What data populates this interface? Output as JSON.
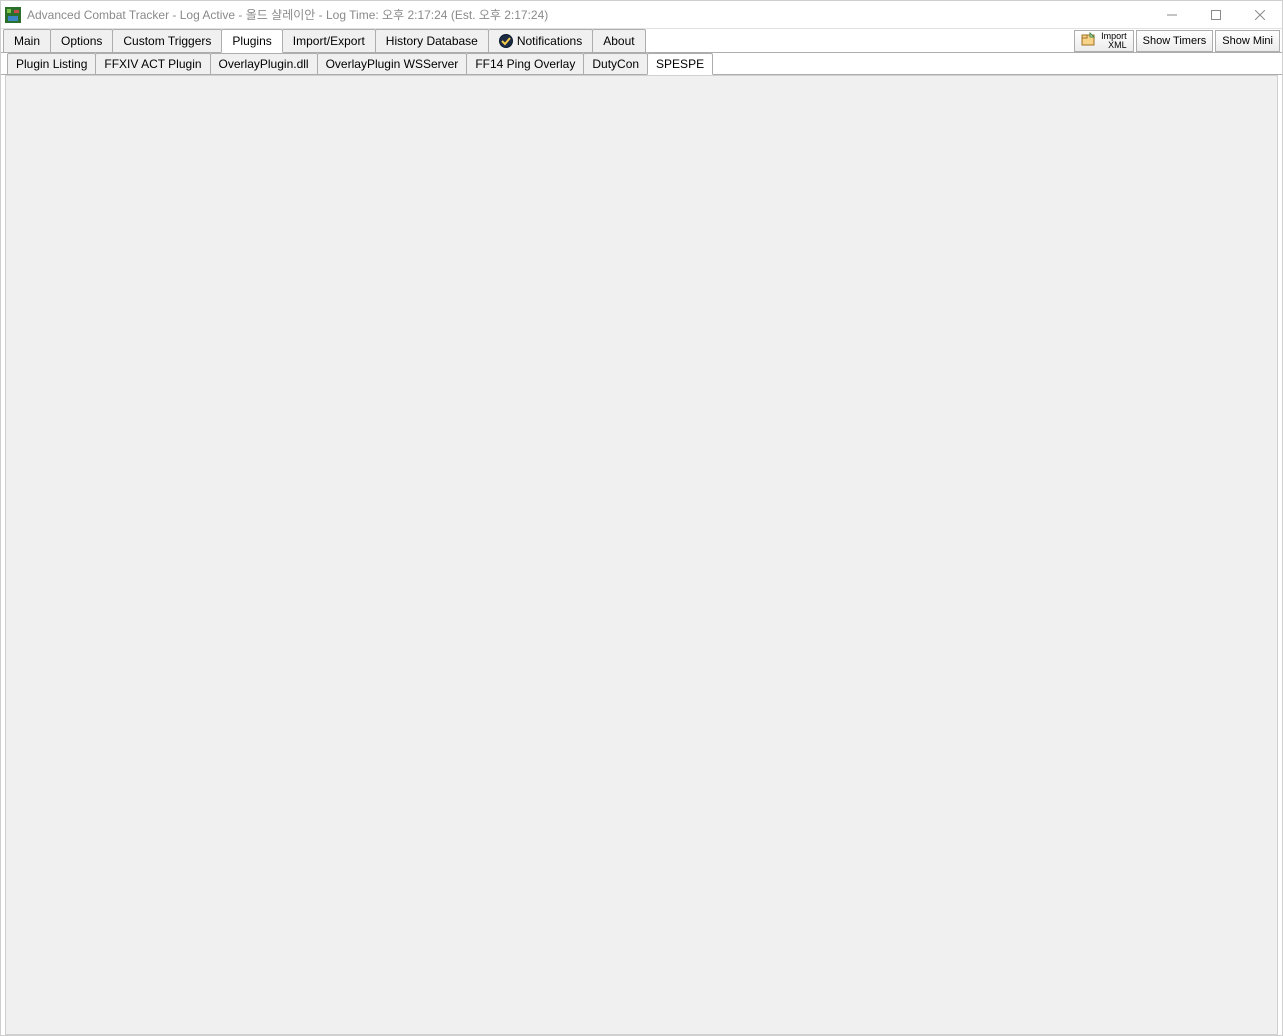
{
  "title": "Advanced Combat Tracker - Log Active - 올드 샬레이안 - Log Time: 오후 2:17:24 (Est. 오후 2:17:24)",
  "mainTabs": {
    "items": [
      {
        "label": "Main"
      },
      {
        "label": "Options"
      },
      {
        "label": "Custom Triggers"
      },
      {
        "label": "Plugins",
        "active": true
      },
      {
        "label": "Import/Export"
      },
      {
        "label": "History Database"
      },
      {
        "label": "Notifications",
        "hasIcon": true
      },
      {
        "label": "About"
      }
    ]
  },
  "rightButtons": {
    "importLine1": "Import",
    "importLine2": "XML",
    "showTimers": "Show Timers",
    "showMini": "Show Mini"
  },
  "subTabs": {
    "items": [
      {
        "label": "Plugin Listing"
      },
      {
        "label": "FFXIV ACT Plugin"
      },
      {
        "label": "OverlayPlugin.dll"
      },
      {
        "label": "OverlayPlugin WSServer"
      },
      {
        "label": "FF14 Ping Overlay"
      },
      {
        "label": "DutyCon"
      },
      {
        "label": "SPESPE",
        "active": true
      }
    ]
  }
}
